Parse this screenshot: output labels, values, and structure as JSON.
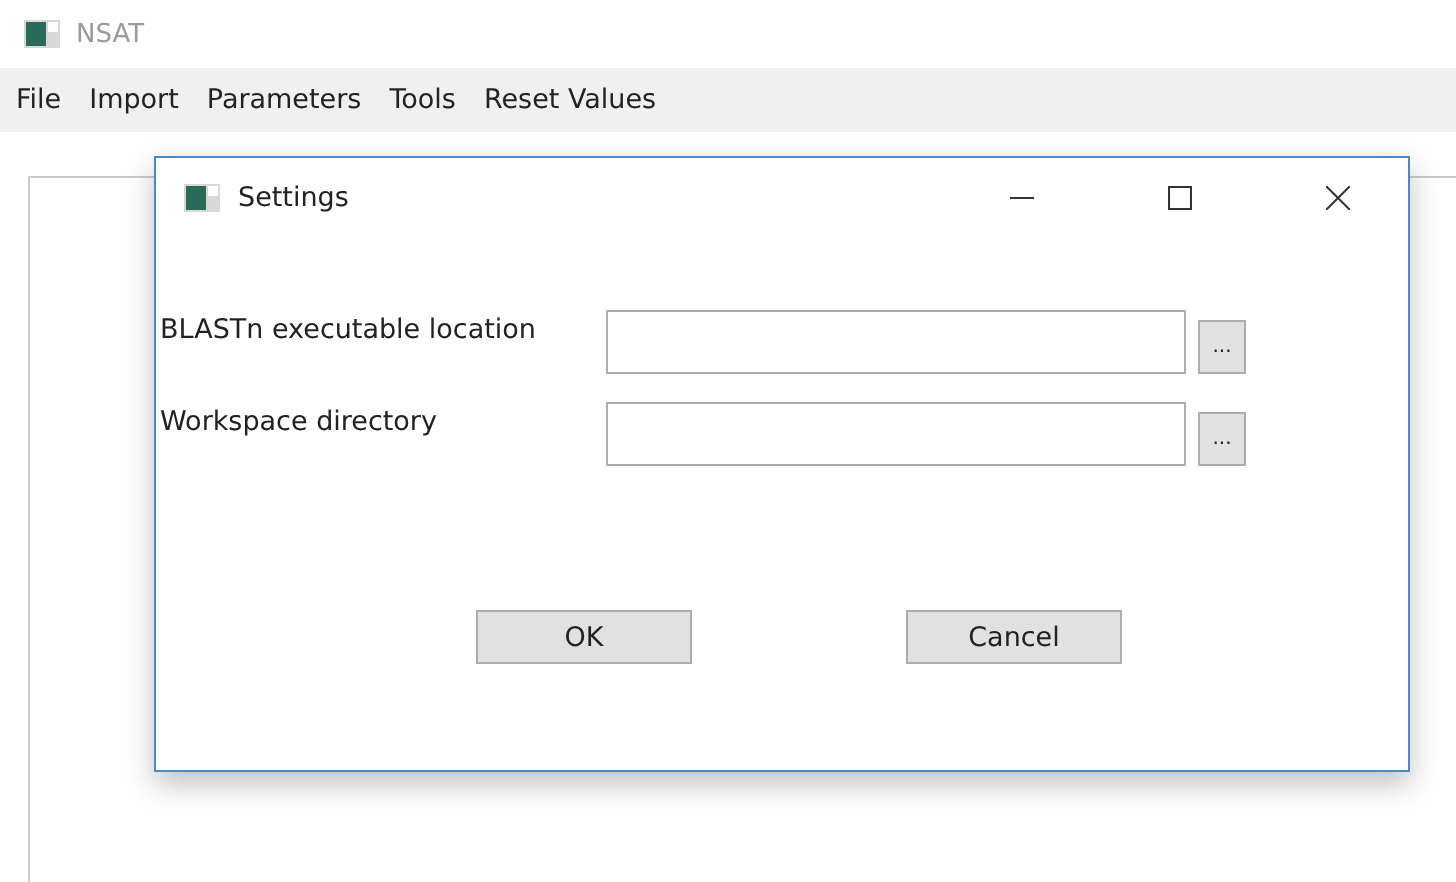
{
  "window": {
    "title": "NSAT"
  },
  "menu": [
    "File",
    "Import",
    "Parameters",
    "Tools",
    "Reset Values"
  ],
  "dialog": {
    "title": "Settings",
    "fields": [
      {
        "label": "BLASTn executable location",
        "browse": "..."
      },
      {
        "label": "Workspace directory",
        "browse": "..."
      }
    ],
    "buttons": [
      "OK",
      "Cancel"
    ]
  }
}
